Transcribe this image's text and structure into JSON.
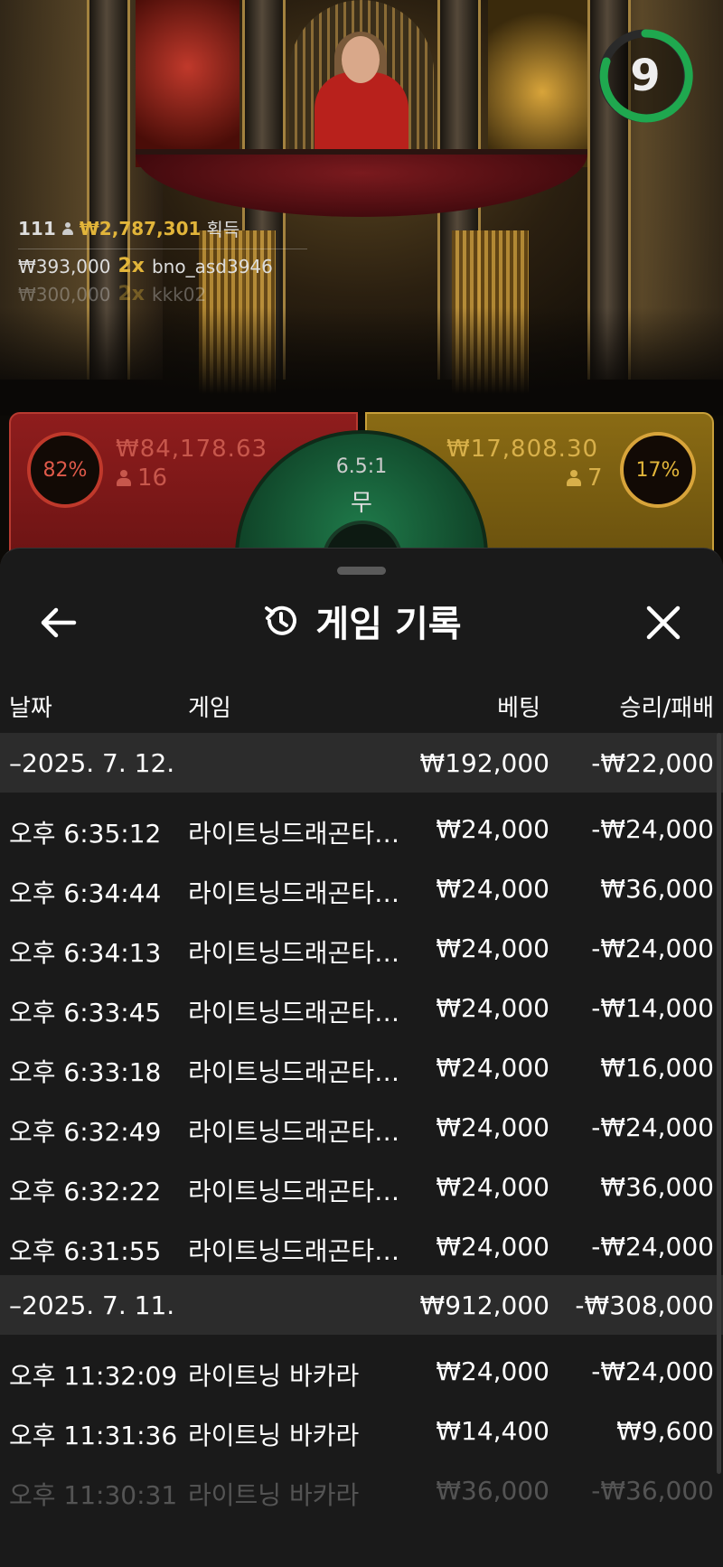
{
  "timer": {
    "value": "9",
    "ring_color": "#1fa84f"
  },
  "winners": {
    "count": "111",
    "amount": "₩2,787,301",
    "label": "획득",
    "rows": [
      {
        "amount": "₩393,000",
        "mult": "2x",
        "user": "bno_asd3946"
      },
      {
        "amount": "₩300,000",
        "mult": "2x",
        "user": "kkk02"
      }
    ]
  },
  "board": {
    "dragon": {
      "percent": "82%",
      "amount": "₩84,178.63",
      "players": "16",
      "color": "#c0392b"
    },
    "tiger": {
      "percent": "17%",
      "amount": "₩17,808.30",
      "players": "7",
      "color": "#d8a43a"
    },
    "tie": {
      "ratio": "6.5:1",
      "label": "무",
      "color": "#1f7a4a"
    }
  },
  "sheet": {
    "title": "게임 기록",
    "icons": {
      "back": "arrow-left-icon",
      "history": "history-icon",
      "close": "close-icon"
    },
    "columns": {
      "date": "날짜",
      "game": "게임",
      "bet": "베팅",
      "result": "승리/패배"
    },
    "groups": [
      {
        "date": "–2025. 7. 12.",
        "total_bet": "₩192,000",
        "total_result": "-₩22,000",
        "rows": [
          {
            "time": "오후 6:35:12",
            "game": "라이트닝드래곤타이거",
            "bet": "₩24,000",
            "result": "-₩24,000"
          },
          {
            "time": "오후 6:34:44",
            "game": "라이트닝드래곤타이거",
            "bet": "₩24,000",
            "result": "₩36,000"
          },
          {
            "time": "오후 6:34:13",
            "game": "라이트닝드래곤타이거",
            "bet": "₩24,000",
            "result": "-₩24,000"
          },
          {
            "time": "오후 6:33:45",
            "game": "라이트닝드래곤타이거",
            "bet": "₩24,000",
            "result": "-₩14,000"
          },
          {
            "time": "오후 6:33:18",
            "game": "라이트닝드래곤타이거",
            "bet": "₩24,000",
            "result": "₩16,000"
          },
          {
            "time": "오후 6:32:49",
            "game": "라이트닝드래곤타이거",
            "bet": "₩24,000",
            "result": "-₩24,000"
          },
          {
            "time": "오후 6:32:22",
            "game": "라이트닝드래곤타이거",
            "bet": "₩24,000",
            "result": "₩36,000"
          },
          {
            "time": "오후 6:31:55",
            "game": "라이트닝드래곤타이거",
            "bet": "₩24,000",
            "result": "-₩24,000"
          }
        ]
      },
      {
        "date": "–2025. 7. 11.",
        "total_bet": "₩912,000",
        "total_result": "-₩308,000",
        "rows": [
          {
            "time": "오후 11:32:09",
            "game": "라이트닝 바카라",
            "bet": "₩24,000",
            "result": "-₩24,000"
          },
          {
            "time": "오후 11:31:36",
            "game": "라이트닝 바카라",
            "bet": "₩14,400",
            "result": "₩9,600"
          },
          {
            "time": "오후 11:30:31",
            "game": "라이트닝 바카라",
            "bet": "₩36,000",
            "result": "-₩36,000"
          }
        ]
      }
    ]
  }
}
